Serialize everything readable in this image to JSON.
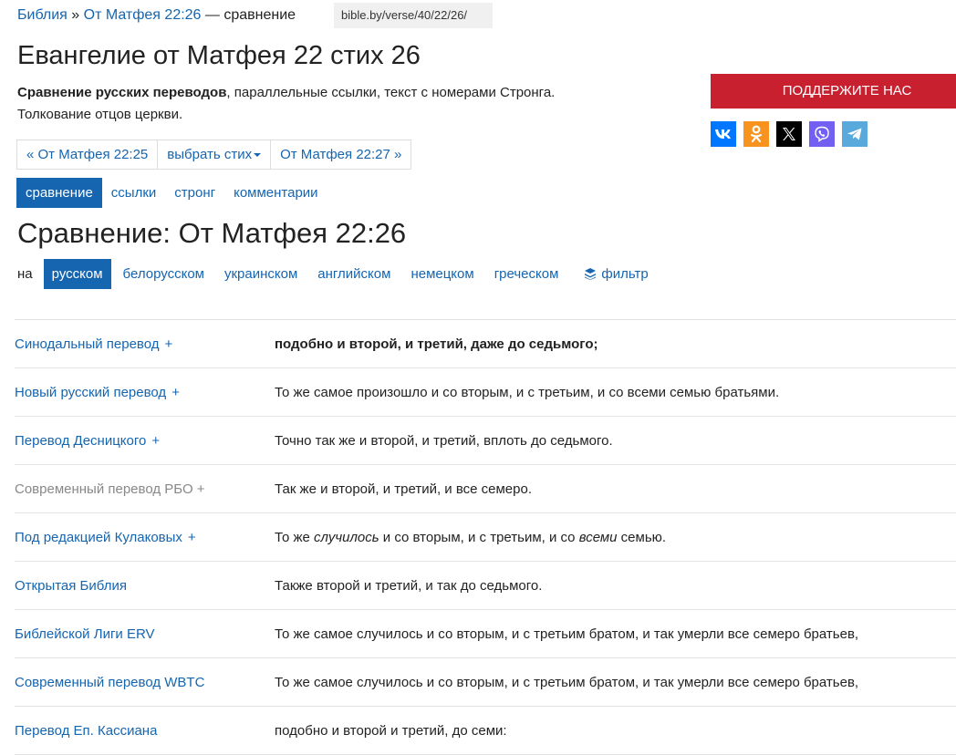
{
  "breadcrumb": {
    "home": "Библия",
    "separator": "»",
    "verse_link": "От Матфея 22:26",
    "suffix": "— сравнение"
  },
  "url": "bible.by/verse/40/22/26/",
  "title": "Евангелие от Матфея 22 стих 26",
  "intro": {
    "bold": "Сравнение русских переводов",
    "line1_rest": ", параллельные ссылки, текст с номерами Стронга.",
    "line2": "Толкование отцов церкви."
  },
  "verse_nav": {
    "prev": "« От Матфея 22:25",
    "select": "выбрать стих",
    "next": "От Матфея 22:27 »"
  },
  "tabs": [
    {
      "label": "сравнение",
      "active": true
    },
    {
      "label": "ссылки",
      "active": false
    },
    {
      "label": "стронг",
      "active": false
    },
    {
      "label": "комментарии",
      "active": false
    }
  ],
  "section_title": "Сравнение: От Матфея 22:26",
  "languages": {
    "prefix": "на",
    "items": [
      {
        "label": "русском",
        "active": true
      },
      {
        "label": "белорусском",
        "active": false
      },
      {
        "label": "украинском",
        "active": false
      },
      {
        "label": "английском",
        "active": false
      },
      {
        "label": "немецком",
        "active": false
      },
      {
        "label": "греческом",
        "active": false
      }
    ],
    "filter": "фильтр"
  },
  "support_button": "ПОДДЕРЖИТЕ НАС",
  "social": [
    {
      "name": "vk-icon",
      "color": "#0077ff"
    },
    {
      "name": "odnoklassniki-icon",
      "color": "#f7931e"
    },
    {
      "name": "x-icon",
      "color": "#000000"
    },
    {
      "name": "viber-icon",
      "color": "#7360f2"
    },
    {
      "name": "telegram-icon",
      "color": "#5aa9dd"
    }
  ],
  "translations": [
    {
      "name": "Синодальный перевод",
      "plus": "+",
      "muted": false,
      "bold": true,
      "text": "подобно и второй, и третий, даже до седьмого;"
    },
    {
      "name": "Новый русский перевод",
      "plus": "+",
      "muted": false,
      "bold": false,
      "text": "То же самое произошло и со вторым, и с третьим, и со всеми семью братьями."
    },
    {
      "name": "Перевод Десницкого",
      "plus": "+",
      "muted": false,
      "bold": false,
      "text": "Точно так же и второй, и третий, вплоть до седьмого."
    },
    {
      "name": "Современный перевод РБО",
      "plus": "+",
      "muted": true,
      "bold": false,
      "text": "Так же и второй, и третий, и все семеро."
    },
    {
      "name": "Под редакцией Кулаковых",
      "plus": "+",
      "muted": false,
      "bold": false,
      "text_parts": [
        "То же ",
        "случилось",
        " и со вторым, и с третьим, и со ",
        "всеми",
        " семью."
      ]
    },
    {
      "name": "Открытая Библия",
      "plus": "",
      "muted": false,
      "bold": false,
      "text": "Также второй и третий, и так до седьмого."
    },
    {
      "name": "Библейской Лиги ERV",
      "plus": "",
      "muted": false,
      "bold": false,
      "text": "То же самое случилось и со вторым, и с третьим братом, и так умерли все семеро братьев,"
    },
    {
      "name": "Современный перевод WBTC",
      "plus": "",
      "muted": false,
      "bold": false,
      "text": "То же самое случилось и со вторым, и с третьим братом, и так умерли все семеро братьев,"
    },
    {
      "name": "Перевод Еп. Кассиана",
      "plus": "",
      "muted": false,
      "bold": false,
      "text": "подобно и второй и третий, до семи:"
    }
  ]
}
